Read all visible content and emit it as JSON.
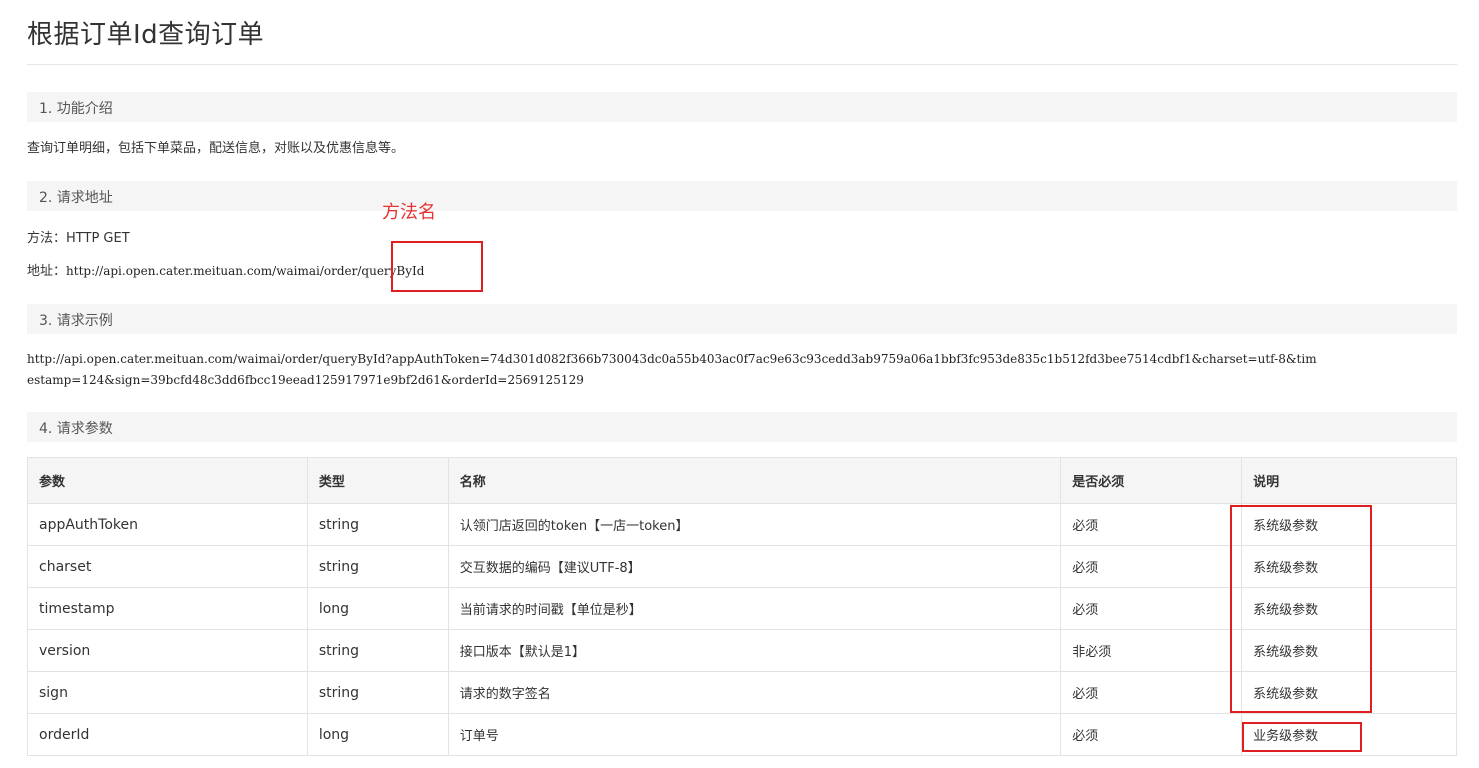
{
  "page_title": "根据订单Id查询订单",
  "sections": [
    {
      "title": "1. 功能介绍"
    },
    {
      "title": "2. 请求地址"
    },
    {
      "title": "3. 请求示例"
    },
    {
      "title": "4. 请求参数"
    }
  ],
  "intro": "查询订单明细，包括下单菜品，配送信息，对账以及优惠信息等。",
  "request": {
    "method_label": "方法：",
    "method_value": "HTTP GET",
    "address_label": "地址：",
    "address_base": "http://api.open.cater.meituan.com/waimai/order/",
    "address_method": "queryById"
  },
  "annotation": {
    "method_name": "方法名"
  },
  "example_url": "http://api.open.cater.meituan.com/waimai/order/queryById?appAuthToken=74d301d082f366b730043dc0a55b403ac0f7ac9e63c93cedd3ab9759a06a1bbf3fc953de835c1b512fd3bee7514cdbf1&charset=utf-8&timestamp=124&sign=39bcfd48c3dd6fbcc19eead125917971e9bf2d61&orderId=2569125129",
  "params_table": {
    "headers": [
      "参数",
      "类型",
      "名称",
      "是否必须",
      "说明"
    ],
    "rows": [
      {
        "param": "appAuthToken",
        "type": "string",
        "name": "认领门店返回的token【一店一token】",
        "required": "必须",
        "note": "系统级参数"
      },
      {
        "param": "charset",
        "type": "string",
        "name": "交互数据的编码【建议UTF-8】",
        "required": "必须",
        "note": "系统级参数"
      },
      {
        "param": "timestamp",
        "type": "long",
        "name": "当前请求的时间戳【单位是秒】",
        "required": "必须",
        "note": "系统级参数"
      },
      {
        "param": "version",
        "type": "string",
        "name": "接口版本【默认是1】",
        "required": "非必须",
        "note": "系统级参数"
      },
      {
        "param": "sign",
        "type": "string",
        "name": "请求的数字签名",
        "required": "必须",
        "note": "系统级参数"
      },
      {
        "param": "orderId",
        "type": "long",
        "name": "订单号",
        "required": "必须",
        "note": "业务级参数"
      }
    ]
  },
  "colors": {
    "annotation_red": "#e02020",
    "section_bg": "#f5f5f5"
  }
}
